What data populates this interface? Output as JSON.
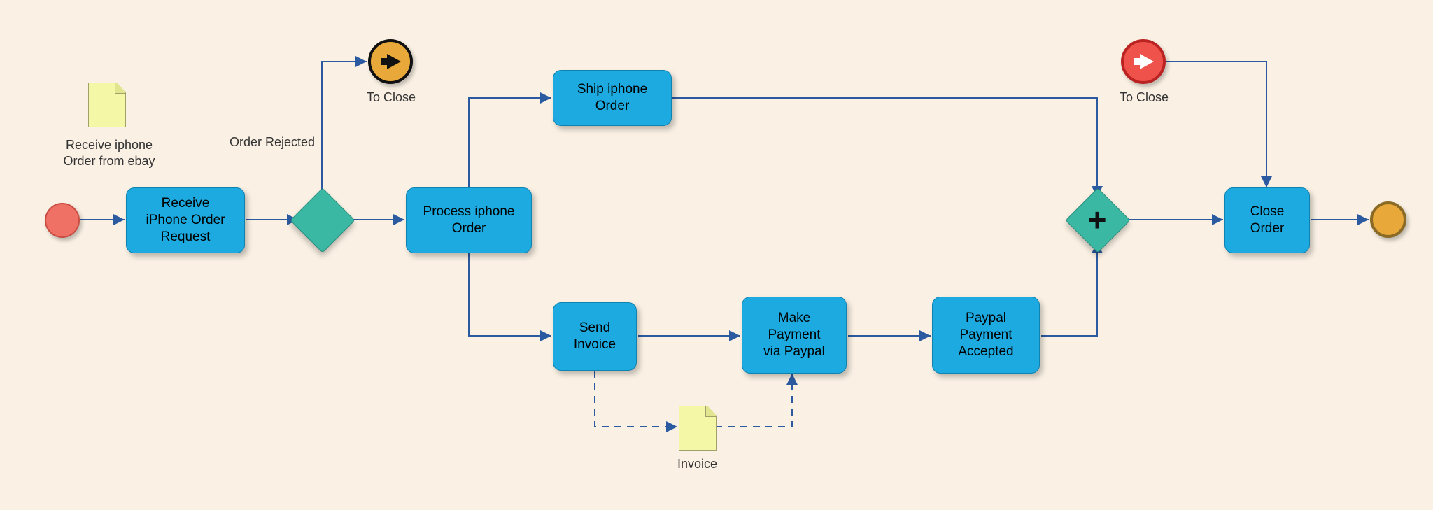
{
  "notes": {
    "receive_note_label": "Receive iphone\nOrder from ebay",
    "invoice_note_label": "Invoice"
  },
  "labels": {
    "order_rejected": "Order Rejected",
    "to_close_throw": "To Close",
    "to_close_catch": "To Close"
  },
  "tasks": {
    "receive": "Receive\niPhone Order\nRequest",
    "process": "Process iphone\nOrder",
    "ship": "Ship iphone\nOrder",
    "send_invoice": "Send\nInvoice",
    "make_payment": "Make\nPayment\nvia Paypal",
    "payment_accepted": "Paypal\nPayment\nAccepted",
    "close": "Close\nOrder"
  }
}
